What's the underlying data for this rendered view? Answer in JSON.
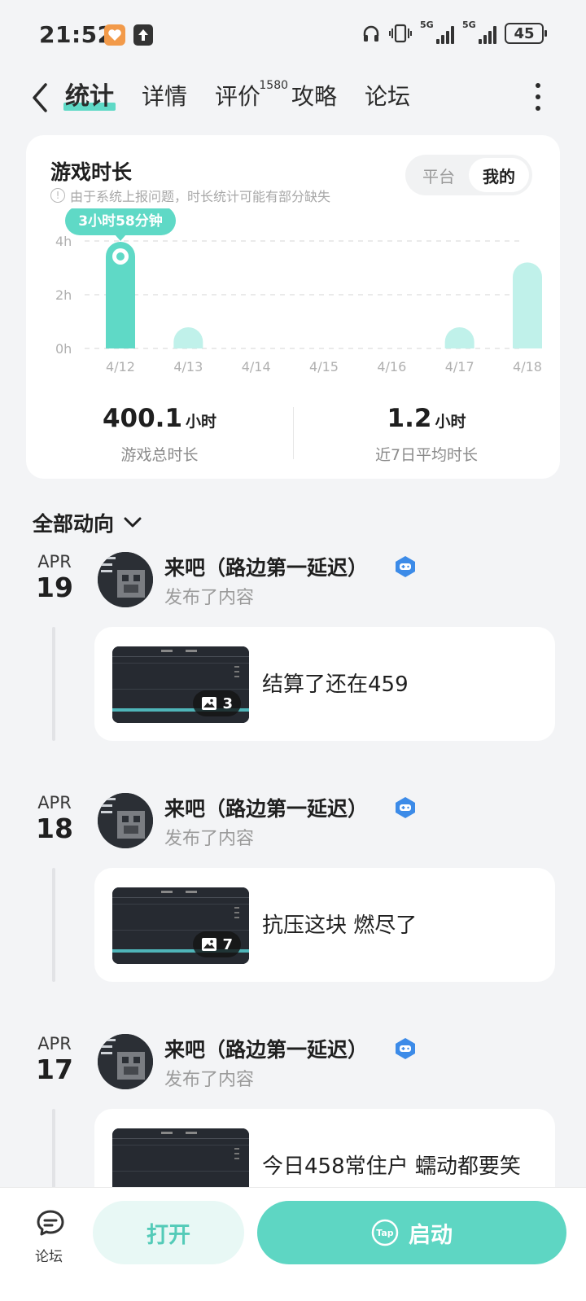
{
  "status_bar": {
    "time": "21:52",
    "battery": "45",
    "net1": "5G",
    "net2": "5G"
  },
  "nav": {
    "tabs": [
      {
        "label": "统计",
        "active": true
      },
      {
        "label": "详情"
      },
      {
        "label": "评价",
        "count": "1580"
      },
      {
        "label": "攻略"
      },
      {
        "label": "论坛"
      }
    ]
  },
  "stats": {
    "title": "游戏时长",
    "note": "由于系统上报问题，时长统计可能有部分缺失",
    "toggle": {
      "platform": "平台",
      "mine": "我的"
    },
    "total": {
      "value": "400.1",
      "unit": "小时",
      "label": "游戏总时长"
    },
    "avg": {
      "value": "1.2",
      "unit": "小时",
      "label": "近7日平均时长"
    }
  },
  "chart_data": {
    "type": "bar",
    "categories": [
      "4/12",
      "4/13",
      "4/14",
      "4/15",
      "4/16",
      "4/17",
      "4/18"
    ],
    "values": [
      3.97,
      0.45,
      0,
      0,
      0,
      0.45,
      3.2
    ],
    "yticks": [
      "4h",
      "2h",
      "0h"
    ],
    "ylim": [
      0,
      4
    ],
    "highlight_index": 0,
    "highlight_label": "3小时58分钟",
    "grid": true,
    "colors": {
      "highlight": "#5fd9c6",
      "normal": "#c0f1ea",
      "grid": "#e4e4e4"
    }
  },
  "activity": {
    "header": "全部动向",
    "entries": [
      {
        "month": "APR",
        "day": "19",
        "name": "来吧（路边第一延迟）",
        "action": "发布了内容",
        "image_count": "3",
        "text": "结算了还在459"
      },
      {
        "month": "APR",
        "day": "18",
        "name": "来吧（路边第一延迟）",
        "action": "发布了内容",
        "image_count": "7",
        "text": "抗压这块 燃尽了"
      },
      {
        "month": "APR",
        "day": "17",
        "name": "来吧（路边第一延迟）",
        "action": "发布了内容",
        "image_count": "",
        "text": "今日458常住户 蠕动都要笑"
      }
    ]
  },
  "bottom": {
    "forum_label": "论坛",
    "open_label": "打开",
    "launch_label": "启动",
    "launch_icon_text": "Tap"
  },
  "colors": {
    "accent": "#5ed6c3",
    "accent_light": "#e8f8f5",
    "badge": "#3c8be8"
  }
}
